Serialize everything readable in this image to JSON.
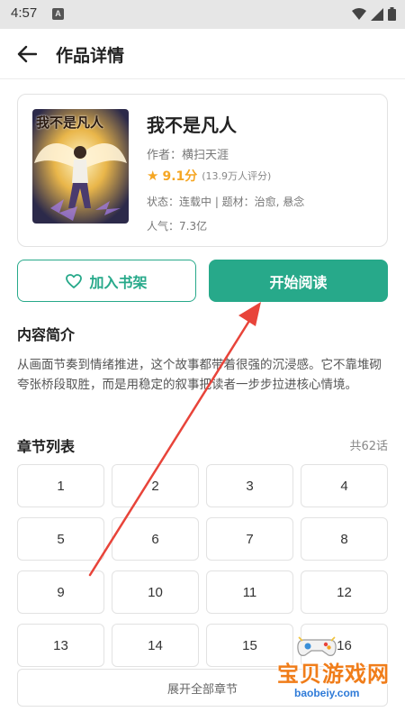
{
  "status_bar": {
    "time": "4:57",
    "notification_letter": "A"
  },
  "app_bar": {
    "title": "作品详情"
  },
  "book": {
    "title": "我不是凡人",
    "cover_text": "我不是凡人",
    "author": "作者：横扫天涯",
    "score": "9.1分",
    "rating_count": "(13.9万人评分)",
    "status_line": "状态：连载中 | 题材：治愈, 悬念",
    "popularity": "人气：7.3亿"
  },
  "actions": {
    "add_shelf_label": "加入书架",
    "start_read_label": "开始阅读"
  },
  "intro": {
    "title": "内容简介",
    "text": "从画面节奏到情绪推进，这个故事都带着很强的沉浸感。它不靠堆砌夸张桥段取胜，而是用稳定的叙事把读者一步步拉进核心情境。"
  },
  "chapters": {
    "title": "章节列表",
    "count_label": "共62话",
    "items": [
      "1",
      "2",
      "3",
      "4",
      "5",
      "6",
      "7",
      "8",
      "9",
      "10",
      "11",
      "12",
      "13",
      "14",
      "15",
      "16"
    ],
    "expand_label": "展开全部章节"
  },
  "watermark": {
    "text": "宝贝游戏网",
    "url": "baobeiy.com"
  },
  "colors": {
    "accent": "#27a98a",
    "star": "#f5a623",
    "annotation_arrow": "#e8443a"
  }
}
